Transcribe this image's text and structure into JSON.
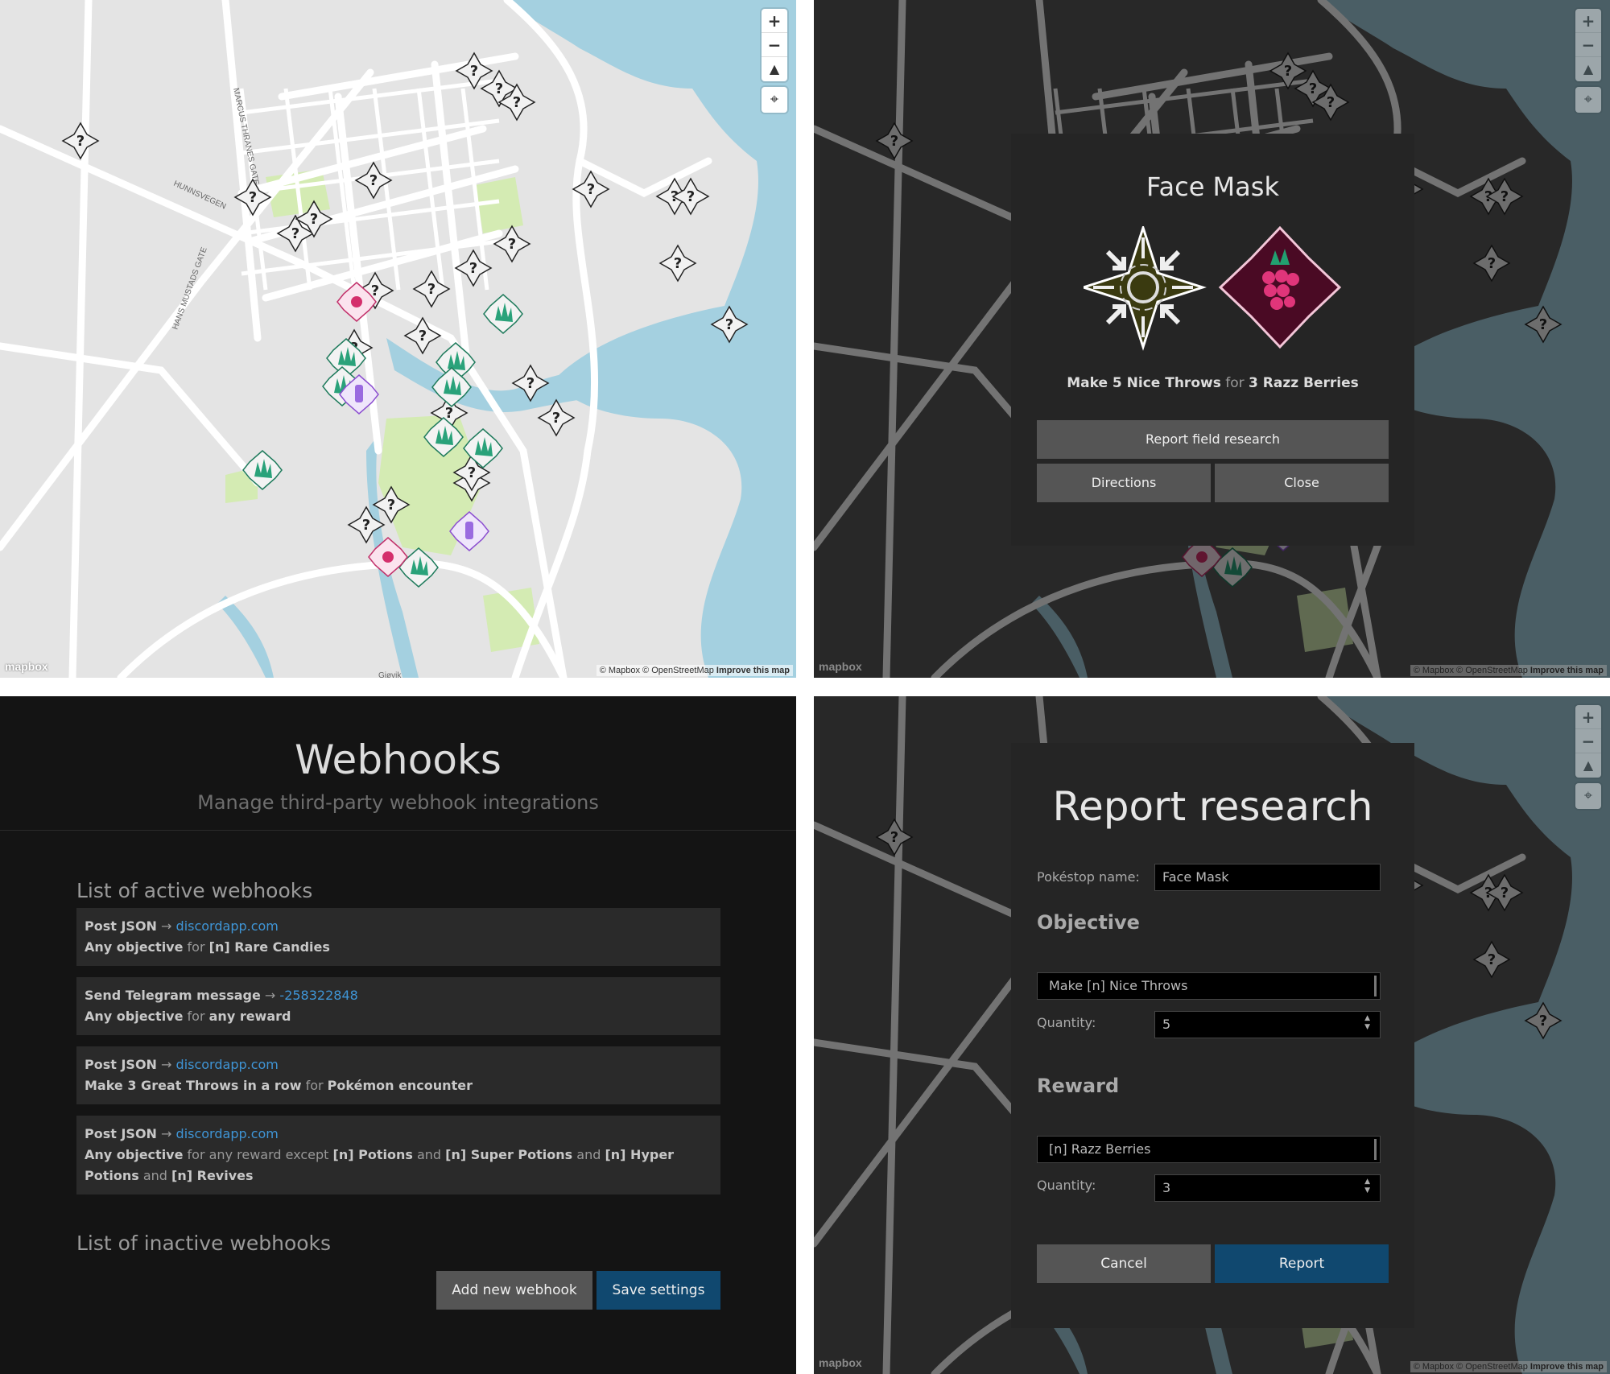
{
  "map": {
    "zoom_in": "+",
    "zoom_out": "−",
    "compass": "▲",
    "geolocate": "⌖",
    "attribution_text": "© Mapbox © OpenStreetMap",
    "attribution_link": "Improve this map",
    "logo": "mapbox",
    "street_labels": [
      "MARCUS THRANES GATE",
      "HUNNSVEGEN",
      "HANS MUSTADS GATE",
      "Gjøvik"
    ],
    "unknown_marker": "?"
  },
  "colors": {
    "water": "#a4d0e0",
    "land": "#e4e4e4",
    "park": "#d4ebb3",
    "road": "#ffffff",
    "accent_blue": "#10486f",
    "link_blue": "#3f95d6"
  },
  "pokestop_popup": {
    "title": "Face Mask",
    "objective_prefix": "Make 5 Nice Throws",
    "for": "for",
    "reward": "3 Razz Berries",
    "objective_icon": "nice-throw-icon",
    "reward_icon": "razz-berry-icon",
    "report_button": "Report field research",
    "directions_button": "Directions",
    "close_button": "Close"
  },
  "webhooks": {
    "title": "Webhooks",
    "subtitle": "Manage third-party webhook integrations",
    "active_heading": "List of active webhooks",
    "inactive_heading": "List of inactive webhooks",
    "items": [
      {
        "action": "Post JSON",
        "arrow": "→",
        "target": "discordapp.com",
        "line2": [
          [
            "b",
            "Any objective"
          ],
          [
            "t",
            " for "
          ],
          [
            "b",
            "[n] Rare Candies"
          ]
        ]
      },
      {
        "action": "Send Telegram message",
        "arrow": "→",
        "target": "-258322848",
        "line2": [
          [
            "b",
            "Any objective"
          ],
          [
            "t",
            " for "
          ],
          [
            "b",
            "any reward"
          ]
        ]
      },
      {
        "action": "Post JSON",
        "arrow": "→",
        "target": "discordapp.com",
        "line2": [
          [
            "b",
            "Make 3 Great Throws in a row"
          ],
          [
            "t",
            " for "
          ],
          [
            "b",
            "Pokémon encounter"
          ]
        ]
      },
      {
        "action": "Post JSON",
        "arrow": "→",
        "target": "discordapp.com",
        "line2": [
          [
            "b",
            "Any objective"
          ],
          [
            "t",
            " for any reward except "
          ],
          [
            "b",
            "[n] Potions"
          ],
          [
            "t",
            " and "
          ],
          [
            "b",
            "[n] Super Potions"
          ],
          [
            "t",
            " and "
          ],
          [
            "b",
            "[n] Hyper Potions"
          ],
          [
            "t",
            " and "
          ],
          [
            "b",
            "[n] Revives"
          ]
        ]
      }
    ],
    "add_button": "Add new webhook",
    "save_button": "Save settings"
  },
  "report_form": {
    "title": "Report research",
    "pokestop_label": "Pokéstop name:",
    "pokestop_value": "Face Mask",
    "objective_heading": "Objective",
    "objective_value": "Make [n] Nice Throws",
    "objective_qty_label": "Quantity:",
    "objective_qty": "5",
    "reward_heading": "Reward",
    "reward_value": "[n] Razz Berries",
    "reward_qty_label": "Quantity:",
    "reward_qty": "3",
    "cancel_button": "Cancel",
    "report_button": "Report"
  }
}
